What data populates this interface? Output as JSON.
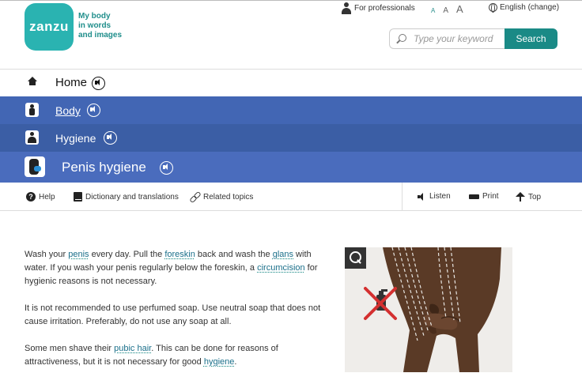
{
  "brand": {
    "logo_text": "zanzu",
    "tagline": [
      "My body",
      "in words",
      "and images"
    ]
  },
  "topbar": {
    "professionals": "For professionals",
    "font_sizes": [
      "A",
      "A",
      "A"
    ],
    "language": "English (change)"
  },
  "search": {
    "placeholder": "Type your keyword",
    "button": "Search"
  },
  "nav": {
    "home": "Home",
    "body": "Body",
    "hygiene": "Hygiene",
    "current": "Penis hygiene"
  },
  "toolbar": {
    "help": "Help",
    "dictionary": "Dictionary and translations",
    "related": "Related topics",
    "listen": "Listen",
    "print": "Print",
    "top": "Top"
  },
  "content": {
    "p1": {
      "t1": "Wash your ",
      "k1": "penis",
      "t2": " every day. Pull the ",
      "k2": "foreskin",
      "t3": " back and wash the ",
      "k3": "glans",
      "t4": " with water. If you wash your penis regularly below the foreskin, a ",
      "k4": "circumcision",
      "t5": " for hygienic reasons is not necessary."
    },
    "p2": "It is not recommended to use perfumed soap. Use neutral soap that does not cause irritation. Preferably, do not use any soap at all.",
    "p3": {
      "t1": "Some men shave their ",
      "k1": "pubic hair",
      "t2": ". This can be done for reasons of attractiveness, but it is not necessary for good ",
      "k2": "hygiene",
      "t3": "."
    }
  },
  "colors": {
    "brand_teal": "#2ab3b1",
    "search_button": "#1a8a86",
    "nav_blue": "#4266b4",
    "link": "#1a6f8a"
  }
}
